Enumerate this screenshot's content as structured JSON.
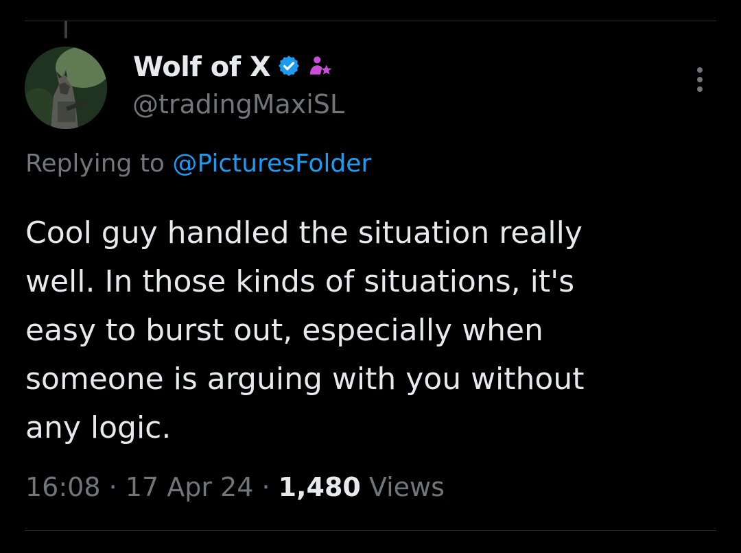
{
  "tweet": {
    "author": {
      "display_name": "Wolf of X",
      "handle": "@tradingMaxiSL",
      "avatar_icon": "wolf-avatar",
      "verified_icon": "verified-badge-icon",
      "affiliate_icon": "subscriber-star-icon"
    },
    "reply_context": {
      "prefix": "Replying to ",
      "mention": "@PicturesFolder"
    },
    "text": "Cool guy handled the situation really\nwell. In those kinds of situations, it's\neasy to burst out, especially when\nsomeone is arguing with you without\nany logic.",
    "meta": {
      "time": "16:08",
      "separator": " · ",
      "date": "17 Apr 24",
      "views_count": "1,480",
      "views_label": " Views"
    },
    "more_icon": "more-vertical-icon"
  },
  "colors": {
    "background": "#000000",
    "text_primary": "#e7e9ea",
    "text_secondary": "#71767b",
    "accent": "#1d9bf0",
    "affiliate": "#c94fd8",
    "divider": "#2f3336"
  }
}
